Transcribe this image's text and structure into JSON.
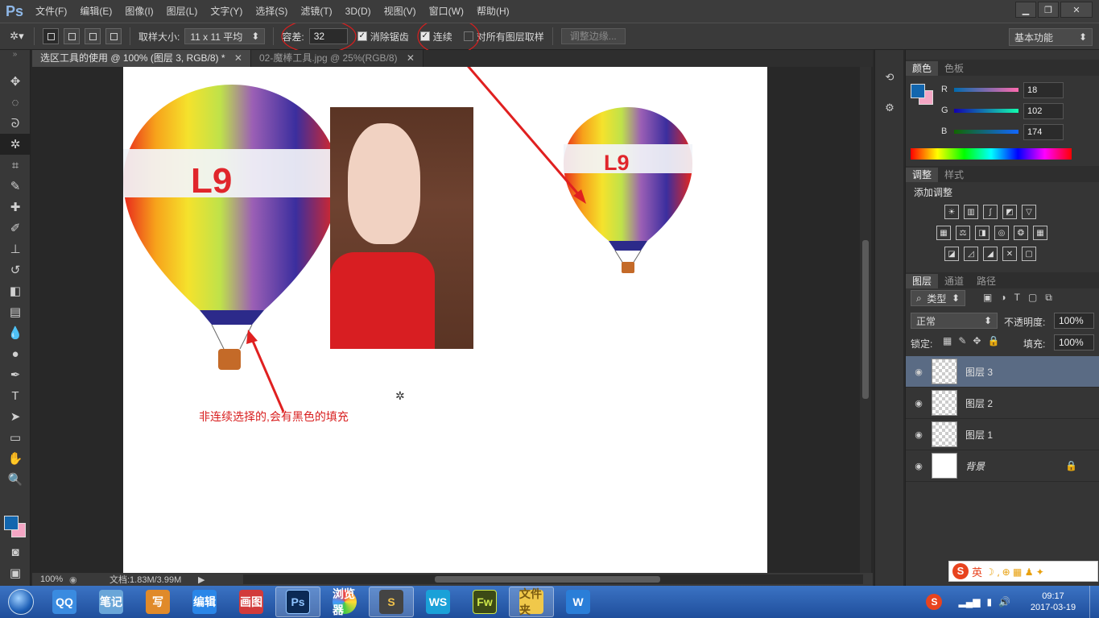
{
  "app": {
    "logo": "Ps"
  },
  "menu": [
    "文件(F)",
    "编辑(E)",
    "图像(I)",
    "图层(L)",
    "文字(Y)",
    "选择(S)",
    "滤镜(T)",
    "3D(D)",
    "视图(V)",
    "窗口(W)",
    "帮助(H)"
  ],
  "window_controls": {
    "minimize": "▁",
    "restore": "❐",
    "close": "✕"
  },
  "options": {
    "sample_size_label": "取样大小:",
    "sample_size_value": "11 x 11 平均",
    "tolerance_label": "容差:",
    "tolerance_value": "32",
    "antialias_label": "消除锯齿",
    "antialias_checked": true,
    "contiguous_label": "连续",
    "contiguous_checked": true,
    "all_layers_label": "对所有图层取样",
    "all_layers_checked": false,
    "refine_edge_label": "调整边缘...",
    "workspace": "基本功能"
  },
  "doc_tabs": [
    {
      "label": "选区工具的使用 @ 100% (图层 3, RGB/8) *",
      "active": true
    },
    {
      "label": "02-魔棒工具.jpg @ 25%(RGB/8)",
      "active": false
    }
  ],
  "canvas": {
    "annotation": "非连续选择的,会有黑色的填充",
    "balloon_text": "L9"
  },
  "status": {
    "zoom": "100%",
    "doc_size": "文档:1.83M/3.99M"
  },
  "color_panel": {
    "tabs": [
      "颜色",
      "色板"
    ],
    "r_label": "R",
    "g_label": "G",
    "b_label": "B",
    "r": "18",
    "g": "102",
    "b": "174",
    "fg_color": "#1266ae",
    "bg_color": "#f4a6c4"
  },
  "adjust_panel": {
    "tabs": [
      "调整",
      "样式"
    ],
    "title": "添加调整"
  },
  "layers_panel": {
    "tabs": [
      "图层",
      "通道",
      "路径"
    ],
    "filter_kind": "类型",
    "blend_mode": "正常",
    "opacity_label": "不透明度:",
    "opacity": "100%",
    "lock_label": "锁定:",
    "fill_label": "填充:",
    "fill": "100%",
    "layers": [
      {
        "name": "图层 3",
        "active": true,
        "locked": false
      },
      {
        "name": "图层 2",
        "active": false,
        "locked": false
      },
      {
        "name": "图层 1",
        "active": false,
        "locked": false
      },
      {
        "name": "背景",
        "active": false,
        "locked": true
      }
    ]
  },
  "taskbar": {
    "apps": [
      "QQ",
      "笔记",
      "写",
      "编辑",
      "画图",
      "Ps",
      "浏览器",
      "S",
      "WS",
      "Fw",
      "文件夹",
      "W"
    ],
    "clock_time": "09:17",
    "clock_date": "2017-03-19",
    "ime_label": "英"
  }
}
